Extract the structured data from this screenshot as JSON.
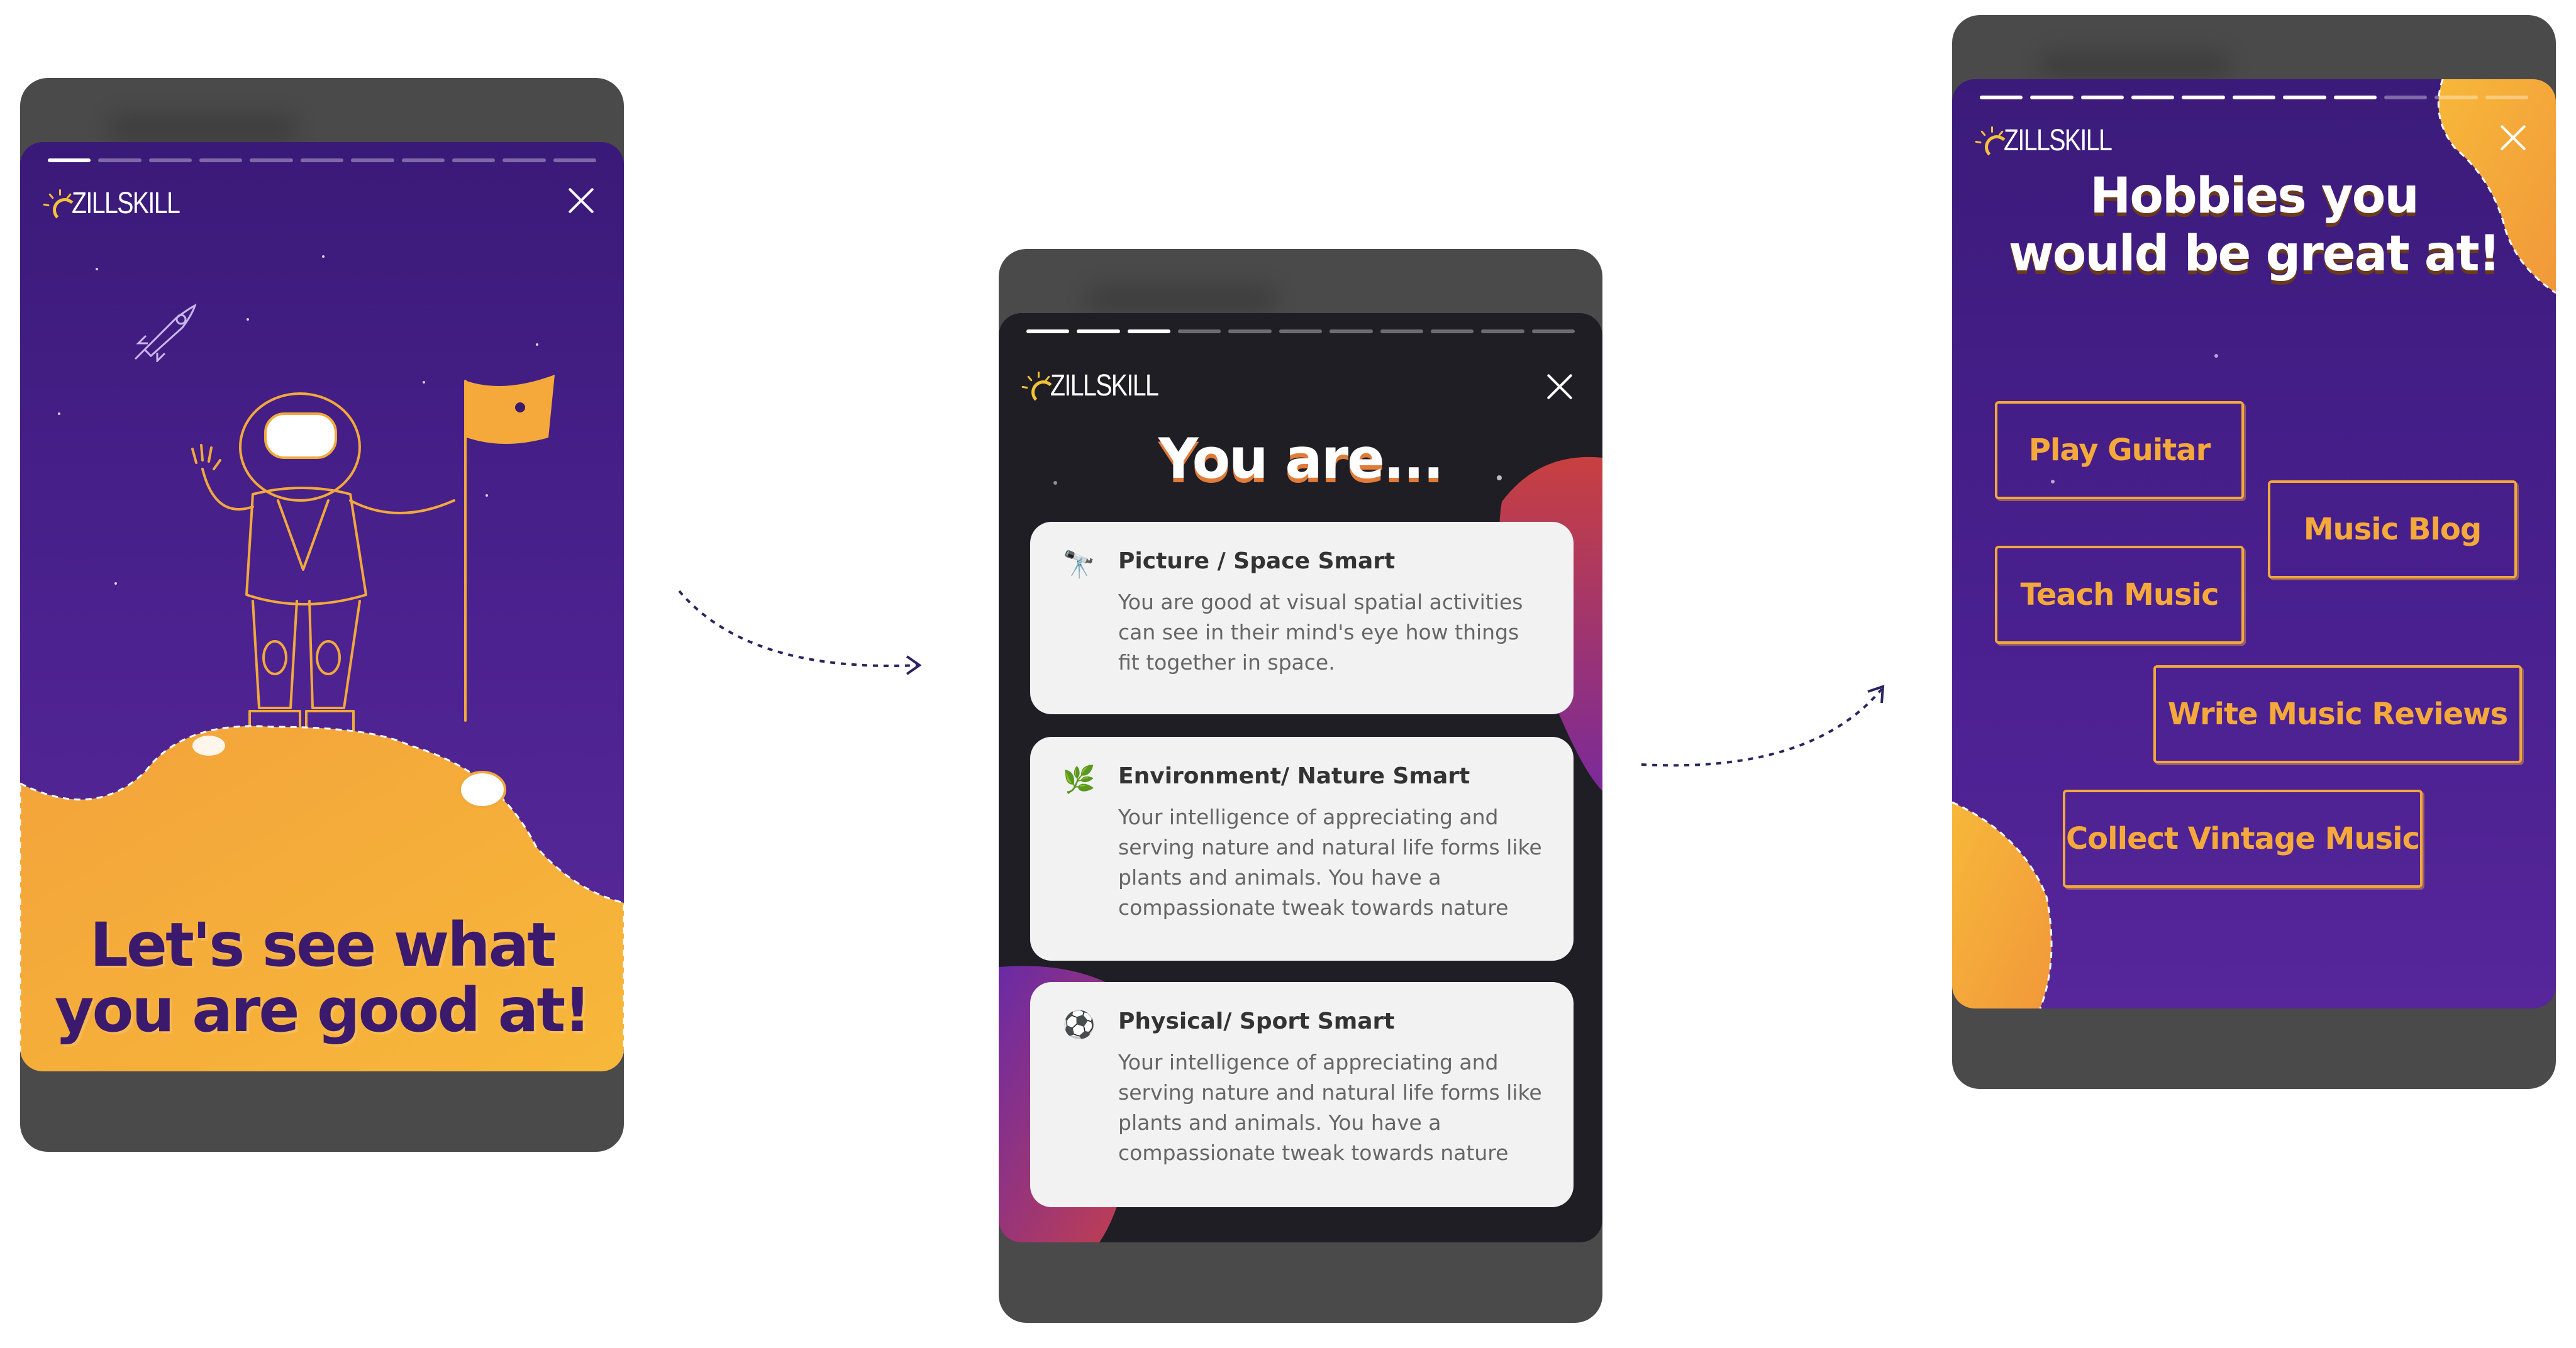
{
  "brand": {
    "name": "ZILLSKILL",
    "purple": "#4a1f86",
    "orange": "#f5a93a",
    "dark": "#1e1d24"
  },
  "screen1": {
    "progress_total": 11,
    "progress_done": 1,
    "headline_line1": "Let's see what",
    "headline_line2": "you are good at!"
  },
  "screen2": {
    "progress_total": 11,
    "progress_done": 3,
    "title": "You are...",
    "cards": [
      {
        "icon": "telescope-icon",
        "title": "Picture / Space Smart",
        "description": "You are good at visual spatial activities can see in their mind's eye how things fit together in space."
      },
      {
        "icon": "leaf-icon",
        "title": "Environment/ Nature Smart",
        "description": "Your intelligence of appreciating and serving nature and natural life forms like plants and animals. You have a compassionate tweak towards nature"
      },
      {
        "icon": "soccer-ball-icon",
        "title": "Physical/ Sport Smart",
        "description": "Your intelligence of appreciating and serving nature and natural life forms like plants and animals. You have a compassionate tweak towards nature"
      }
    ]
  },
  "screen3": {
    "progress_total": 11,
    "progress_done": 8,
    "title_line1": "Hobbies you",
    "title_line2": "would be great at!",
    "hobbies": [
      "Play Guitar",
      "Music Blog",
      "Teach Music",
      "Write Music Reviews",
      "Collect Vintage Music"
    ]
  }
}
